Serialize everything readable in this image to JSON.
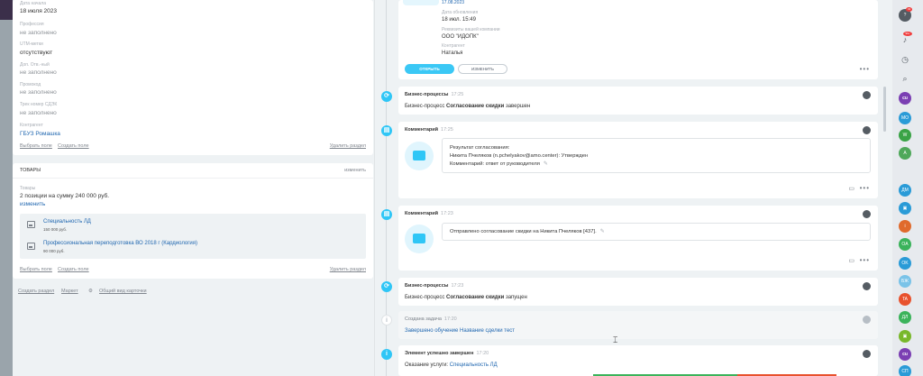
{
  "crm_fields": {
    "date_start_label": "Дата начала",
    "date_start_value": "18 июля 2023",
    "profession_label": "Профессия",
    "profession_value": "не заполнено",
    "utm_label": "UTM-метки",
    "utm_value": "отсутствуют",
    "extra_phone_label": "Доп. Отв.-ный",
    "extra_phone_value": "не заполнено",
    "promo_label": "Промокод",
    "promo_value": "не заполнено",
    "tk_label": "Трек номер СДЭК",
    "tk_value": "не заполнено",
    "contractor_label": "Контрагент",
    "contractor_value": "ГБУЗ Ромашка",
    "select_field": "Выбрать поле",
    "create_field": "Создать поле",
    "delete_section": "Удалить раздел"
  },
  "goods": {
    "title": "ТОВАРЫ",
    "edit": "изменить",
    "label": "Товары",
    "summary": "2 позиции на сумму 240 000 руб.",
    "change_link": "изменить",
    "items": [
      {
        "name": "Специальность ЛД",
        "price": "150 000 руб."
      },
      {
        "name": "Профессиональная переподготовка ВО 2018 г (Кардиология)",
        "price": "90 000 руб."
      }
    ],
    "select_field": "Выбрать поле",
    "create_field": "Создать поле",
    "delete_section": "Удалить раздел"
  },
  "bottom_links": {
    "create_section": "Создать раздел",
    "market": "Маркет",
    "general_view": "Общий вид карточки"
  },
  "doc_card": {
    "date_top": "17.08.2023",
    "update_label": "Дата обновления",
    "update_value": "18 июл. 15:49",
    "company_label": "Реквизиты вашей компании",
    "company_value": "ООО \"ИДОПК\"",
    "contractor_label": "Контрагент",
    "contractor_value": "Наталья",
    "open_btn": "ОТКРЫТЬ",
    "change_btn": "ИЗМЕНИТЬ"
  },
  "timeline": [
    {
      "title": "Бизнес-процессы",
      "time": "17:25",
      "body_prefix": "Бизнес-процесс ",
      "body_bold": "Согласование скидки",
      "body_suffix": " завершен"
    },
    {
      "title": "Комментарий",
      "time": "17:25",
      "line1": "Результат согласования:",
      "line2": "Никита Пчеляков (n.pchelyakov@amo.center): Утвержден",
      "line3": "Комментарий: ответ от руководителя"
    },
    {
      "title": "Комментарий",
      "time": "17:23",
      "line1": "Отправлено согласование скидки на Никита Пчеляков [437]."
    },
    {
      "title": "Бизнес-процессы",
      "time": "17:23",
      "body_prefix": "Бизнес-процесс ",
      "body_bold": "Согласование скидки",
      "body_suffix": " запущен"
    },
    {
      "title": "Создана задача",
      "time": "17:20",
      "link": "Завершено обучение Название сделки тест"
    },
    {
      "title": "Элемент успешно завершен",
      "time": "17:20",
      "body_prefix": "Оказание услуги: ",
      "link": "Специальность ЛД"
    }
  ],
  "right_bar": {
    "notif_badge": "43",
    "bell_badge": "99+",
    "avatars": [
      "MO",
      "W",
      "A",
      "ДМ",
      "",
      "",
      "OA",
      "OK",
      "БЖ",
      "TA",
      "ДЛ",
      "",
      "",
      "СП"
    ],
    "colors": [
      "#2a9bd7",
      "#3aa346",
      "#4fa85a",
      "#2a9bd7",
      "#2a9bd7",
      "#e06a2c",
      "#3bb35b",
      "#2a9bd7",
      "#7ac3e8",
      "#e8522e",
      "#3bb35b",
      "#79b82b",
      "#7b3fb3",
      "#2a9bd7"
    ]
  }
}
